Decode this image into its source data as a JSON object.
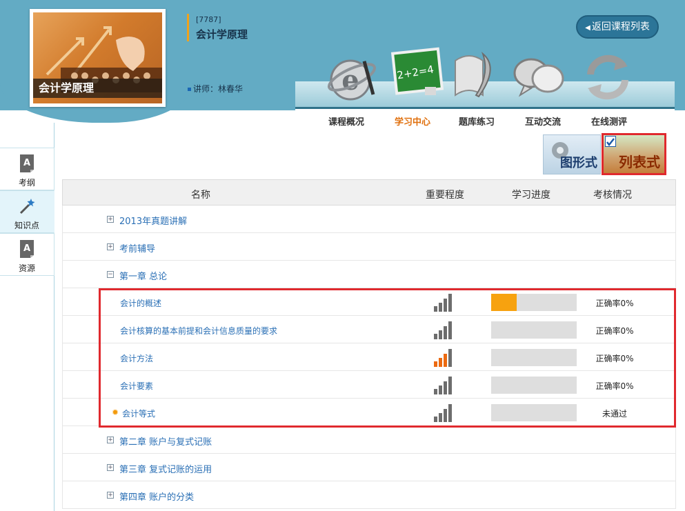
{
  "header": {
    "thumbnail_caption": "会计学原理",
    "course_id": "[7787]",
    "course_name": "会计学原理",
    "teacher": "讲师：林春华",
    "back_button": "返回课程列表"
  },
  "nav": {
    "items": [
      {
        "label": "课程概况",
        "icon": "ie-globe-icon",
        "active": false
      },
      {
        "label": "学习中心",
        "icon": "blackboard-icon",
        "active": true
      },
      {
        "label": "题库练习",
        "icon": "scroll-quill-icon",
        "active": false
      },
      {
        "label": "互动交流",
        "icon": "speech-bubbles-icon",
        "active": false
      },
      {
        "label": "在线测评",
        "icon": "refresh-arrows-icon",
        "active": false
      }
    ]
  },
  "sidebar": {
    "items": [
      {
        "label": "考纲",
        "icon": "document-a-icon",
        "active": false
      },
      {
        "label": "知识点",
        "icon": "magic-wand-icon",
        "active": true
      },
      {
        "label": "资源",
        "icon": "document-a-icon",
        "active": false
      }
    ]
  },
  "view_toggle": {
    "graph_label": "图形式",
    "list_label": "列表式",
    "selected": "list"
  },
  "table": {
    "headers": {
      "name": "名称",
      "importance": "重要程度",
      "progress": "学习进度",
      "assessment": "考核情况"
    },
    "rows": [
      {
        "type": "chapter",
        "expanded": false,
        "title": "2013年真题讲解"
      },
      {
        "type": "chapter",
        "expanded": false,
        "title": "考前辅导"
      },
      {
        "type": "chapter",
        "expanded": true,
        "title": "第一章 总论"
      },
      {
        "type": "item",
        "title": "会计的概述",
        "importance_level": 0,
        "progress": 0.3,
        "result": "正确率0%",
        "marker": false
      },
      {
        "type": "item",
        "title": "会计核算的基本前提和会计信息质量的要求",
        "importance_level": 0,
        "progress": 0,
        "result": "正确率0%",
        "marker": false
      },
      {
        "type": "item",
        "title": "会计方法",
        "importance_level": 3,
        "progress": 0,
        "result": "正确率0%",
        "marker": false
      },
      {
        "type": "item",
        "title": "会计要素",
        "importance_level": 0,
        "progress": 0,
        "result": "正确率0%",
        "marker": false
      },
      {
        "type": "item",
        "title": "会计等式",
        "importance_level": 0,
        "progress": 0,
        "result": "未通过",
        "marker": true
      },
      {
        "type": "chapter",
        "expanded": false,
        "title": "第二章 账户与复式记账"
      },
      {
        "type": "chapter",
        "expanded": false,
        "title": "第三章 复式记账的运用"
      },
      {
        "type": "chapter",
        "expanded": false,
        "title": "第四章 账户的分类"
      }
    ]
  },
  "colors": {
    "header_bg": "#63abc4",
    "accent_orange": "#f7a20f",
    "active_nav": "#e06f0c",
    "link_blue": "#2a6fb5",
    "highlight_red": "#e0292e"
  }
}
